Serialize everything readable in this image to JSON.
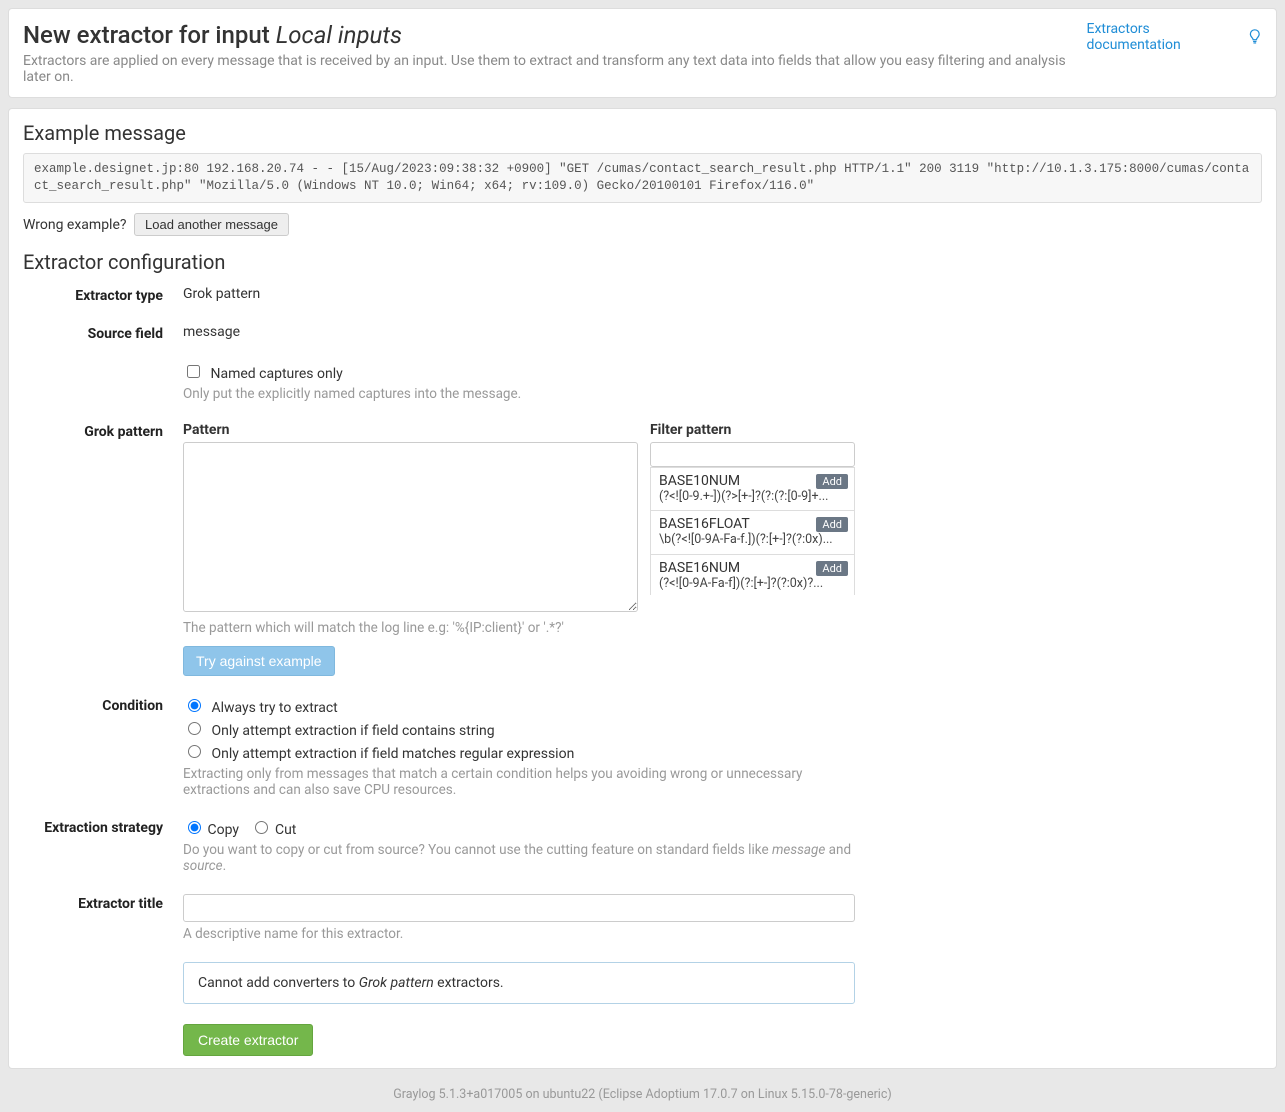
{
  "header": {
    "title_prefix": "New extractor for input ",
    "input_name": "Local inputs",
    "subtitle": "Extractors are applied on every message that is received by an input. Use them to extract and transform any text data into fields that allow you easy filtering and analysis later on.",
    "doc_link": "Extractors documentation"
  },
  "example": {
    "heading": "Example message",
    "message": "example.designet.jp:80 192.168.20.74 - - [15/Aug/2023:09:38:32 +0900] \"GET /cumas/contact_search_result.php HTTP/1.1\" 200 3119 \"http://10.1.3.175:8000/cumas/contact_search_result.php\" \"Mozilla/5.0 (Windows NT 10.0; Win64; x64; rv:109.0) Gecko/20100101 Firefox/116.0\"",
    "wrong_label": "Wrong example?",
    "load_btn": "Load another message"
  },
  "config": {
    "heading": "Extractor configuration",
    "extractor_type_label": "Extractor type",
    "extractor_type_value": "Grok pattern",
    "source_field_label": "Source field",
    "source_field_value": "message",
    "named_captures_label": "Named captures only",
    "named_captures_help": "Only put the explicitly named captures into the message.",
    "grok_pattern_label": "Grok pattern",
    "pattern_label": "Pattern",
    "pattern_help": "The pattern which will match the log line e.g: '%{IP:client}' or '.*?'",
    "filter_label": "Filter pattern",
    "patterns": [
      {
        "name": "BASE10NUM",
        "regex": "(?<![0-9.+-])(?>[+-]?(?:(?:[0-9]+...",
        "add": "Add"
      },
      {
        "name": "BASE16FLOAT",
        "regex": "\\b(?<![0-9A-Fa-f.])(?:[+-]?(?:0x)...",
        "add": "Add"
      },
      {
        "name": "BASE16NUM",
        "regex": "(?<![0-9A-Fa-f])(?:[+-]?(?:0x)?...",
        "add": "Add"
      }
    ],
    "try_btn": "Try against example",
    "condition_label": "Condition",
    "condition_opts": {
      "always": "Always try to extract",
      "contains": "Only attempt extraction if field contains string",
      "regex": "Only attempt extraction if field matches regular expression"
    },
    "condition_help": "Extracting only from messages that match a certain condition helps you avoiding wrong or unnecessary extractions and can also save CPU resources.",
    "strategy_label": "Extraction strategy",
    "strategy_copy": "Copy",
    "strategy_cut": "Cut",
    "strategy_help_pre": "Do you want to copy or cut from source? You cannot use the cutting feature on standard fields like ",
    "strategy_help_em1": "message",
    "strategy_help_mid": " and ",
    "strategy_help_em2": "source",
    "strategy_help_post": ".",
    "title_label": "Extractor title",
    "title_help": "A descriptive name for this extractor.",
    "converter_notice_pre": "Cannot add converters to ",
    "converter_notice_em": "Grok pattern",
    "converter_notice_post": " extractors.",
    "create_btn": "Create extractor"
  },
  "footer": "Graylog 5.1.3+a017005 on ubuntu22 (Eclipse Adoptium 17.0.7 on Linux 5.15.0-78-generic)"
}
